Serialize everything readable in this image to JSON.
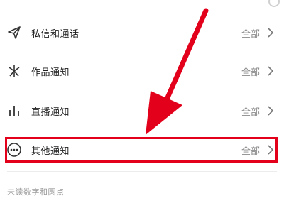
{
  "settings": {
    "items": [
      {
        "label": "私信和通话",
        "value": "全部",
        "icon": "paper-plane-icon"
      },
      {
        "label": "作品通知",
        "value": "全部",
        "icon": "sparkle-icon"
      },
      {
        "label": "直播通知",
        "value": "全部",
        "icon": "bar-chart-icon"
      },
      {
        "label": "其他通知",
        "value": "全部",
        "icon": "more-circle-icon"
      }
    ],
    "footer": "未读数字和圆点"
  },
  "annotation": {
    "color": "#e2001a"
  }
}
